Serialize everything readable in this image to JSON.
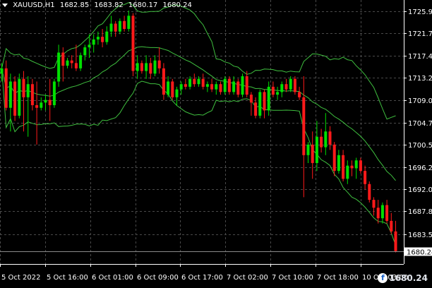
{
  "header": {
    "symbol": "XAUUSD,H1",
    "ohlc": [
      "1682.85",
      "1683.82",
      "1680.17",
      "1680.24"
    ]
  },
  "current_price_label": "1680.24",
  "watermark": "f 1680.24",
  "colors": {
    "background": "#000000",
    "bull": "#00e000",
    "bear": "#ff1a1a",
    "grid": "#4a4a4a",
    "bands": "#3fbf3f",
    "axis_text": "#ffffff"
  },
  "chart_data": {
    "type": "candlestick",
    "title": "",
    "xlabel": "",
    "ylabel": "",
    "ylim": [
      1677.8,
      1728.0
    ],
    "y_ticks": [
      "1725.90",
      "1721.75",
      "1717.40",
      "1713.20",
      "1709.00",
      "1704.70",
      "1700.55",
      "1696.20",
      "1692.00",
      "1687.80",
      "1683.50"
    ],
    "x_ticks": [
      "5 Oct 2022",
      "5 Oct 16:00",
      "6 Oct 01:00",
      "6 Oct 09:00",
      "6 Oct 17:00",
      "7 Oct 02:00",
      "7 Oct 10:00",
      "7 Oct 18:00",
      "10 Oct 03:00"
    ],
    "grid": true,
    "indicator": "Bollinger Bands",
    "candles_ohlc": [
      [
        1714.0,
        1716.0,
        1712.5,
        1715.0
      ],
      [
        1715.0,
        1716.5,
        1707.0,
        1707.5
      ],
      [
        1707.5,
        1714.0,
        1703.0,
        1712.5
      ],
      [
        1712.5,
        1713.5,
        1705.0,
        1706.0
      ],
      [
        1706.0,
        1714.0,
        1705.5,
        1713.0
      ],
      [
        1713.0,
        1714.5,
        1703.0,
        1709.5
      ],
      [
        1709.5,
        1713.5,
        1702.0,
        1712.0
      ],
      [
        1712.0,
        1713.0,
        1707.0,
        1708.0
      ],
      [
        1708.0,
        1712.5,
        1700.5,
        1707.5
      ],
      [
        1707.5,
        1709.5,
        1707.0,
        1708.5
      ],
      [
        1708.5,
        1710.0,
        1707.0,
        1709.0
      ],
      [
        1709.0,
        1713.0,
        1705.0,
        1708.0
      ],
      [
        1708.0,
        1713.0,
        1707.5,
        1712.5
      ],
      [
        1712.5,
        1719.5,
        1711.5,
        1718.0
      ],
      [
        1718.0,
        1719.0,
        1712.5,
        1715.5
      ],
      [
        1715.5,
        1717.0,
        1715.0,
        1716.5
      ],
      [
        1716.5,
        1717.5,
        1715.0,
        1716.0
      ],
      [
        1716.0,
        1719.5,
        1714.5,
        1715.0
      ],
      [
        1715.0,
        1718.0,
        1714.5,
        1717.5
      ],
      [
        1717.5,
        1719.5,
        1716.5,
        1719.0
      ],
      [
        1719.0,
        1721.5,
        1717.0,
        1719.5
      ],
      [
        1719.5,
        1721.5,
        1718.0,
        1720.5
      ],
      [
        1720.5,
        1722.0,
        1719.5,
        1721.0
      ],
      [
        1721.0,
        1722.5,
        1719.0,
        1720.0
      ],
      [
        1720.0,
        1723.0,
        1719.5,
        1722.0
      ],
      [
        1722.0,
        1725.0,
        1721.0,
        1723.5
      ],
      [
        1723.5,
        1724.0,
        1721.0,
        1722.0
      ],
      [
        1722.0,
        1724.5,
        1721.5,
        1724.0
      ],
      [
        1724.0,
        1725.0,
        1722.0,
        1722.5
      ],
      [
        1722.5,
        1726.0,
        1722.0,
        1725.0
      ],
      [
        1725.0,
        1725.5,
        1713.5,
        1714.5
      ],
      [
        1714.5,
        1717.5,
        1713.0,
        1716.0
      ],
      [
        1716.0,
        1716.5,
        1714.0,
        1714.5
      ],
      [
        1714.5,
        1717.5,
        1713.0,
        1716.0
      ],
      [
        1716.0,
        1717.0,
        1713.0,
        1714.0
      ],
      [
        1714.0,
        1717.5,
        1713.5,
        1716.5
      ],
      [
        1716.5,
        1719.0,
        1714.0,
        1715.0
      ],
      [
        1715.0,
        1716.0,
        1709.0,
        1710.0
      ],
      [
        1710.0,
        1713.5,
        1709.5,
        1712.5
      ],
      [
        1712.5,
        1713.0,
        1709.0,
        1709.5
      ],
      [
        1709.5,
        1711.5,
        1708.0,
        1711.0
      ],
      [
        1711.0,
        1712.5,
        1710.0,
        1712.0
      ],
      [
        1712.0,
        1713.0,
        1711.0,
        1711.5
      ],
      [
        1711.5,
        1713.5,
        1711.0,
        1713.0
      ],
      [
        1713.0,
        1714.0,
        1711.5,
        1712.0
      ],
      [
        1712.0,
        1713.5,
        1711.5,
        1713.0
      ],
      [
        1713.0,
        1714.0,
        1711.0,
        1711.5
      ],
      [
        1711.5,
        1712.5,
        1710.5,
        1712.0
      ],
      [
        1712.0,
        1713.0,
        1710.5,
        1711.0
      ],
      [
        1711.0,
        1712.5,
        1710.0,
        1712.0
      ],
      [
        1712.0,
        1712.5,
        1710.0,
        1710.5
      ],
      [
        1710.5,
        1713.5,
        1710.0,
        1713.0
      ],
      [
        1713.0,
        1713.5,
        1710.0,
        1710.5
      ],
      [
        1710.5,
        1713.5,
        1710.0,
        1712.5
      ],
      [
        1712.5,
        1713.0,
        1709.5,
        1710.0
      ],
      [
        1710.0,
        1714.0,
        1709.5,
        1713.5
      ],
      [
        1713.5,
        1714.5,
        1709.5,
        1710.0
      ],
      [
        1710.0,
        1710.5,
        1706.0,
        1708.5
      ],
      [
        1708.5,
        1709.5,
        1705.5,
        1706.0
      ],
      [
        1706.0,
        1711.0,
        1705.5,
        1710.5
      ],
      [
        1710.5,
        1711.0,
        1705.5,
        1707.0
      ],
      [
        1707.0,
        1712.5,
        1706.0,
        1711.5
      ],
      [
        1711.5,
        1712.5,
        1709.5,
        1710.0
      ],
      [
        1710.0,
        1711.5,
        1709.0,
        1710.5
      ],
      [
        1710.5,
        1712.5,
        1709.5,
        1712.0
      ],
      [
        1712.0,
        1713.0,
        1710.5,
        1711.0
      ],
      [
        1711.0,
        1713.5,
        1710.5,
        1713.0
      ],
      [
        1713.0,
        1713.5,
        1710.0,
        1710.5
      ],
      [
        1710.5,
        1711.5,
        1709.0,
        1709.5
      ],
      [
        1709.5,
        1713.5,
        1690.5,
        1698.5
      ],
      [
        1698.5,
        1701.0,
        1697.0,
        1700.5
      ],
      [
        1700.5,
        1703.0,
        1694.0,
        1697.0
      ],
      [
        1697.0,
        1705.0,
        1695.5,
        1702.0
      ],
      [
        1702.0,
        1703.5,
        1699.0,
        1700.0
      ],
      [
        1700.0,
        1706.5,
        1698.5,
        1703.0
      ],
      [
        1703.0,
        1704.0,
        1699.5,
        1700.5
      ],
      [
        1700.5,
        1701.0,
        1694.5,
        1695.5
      ],
      [
        1695.5,
        1699.5,
        1695.0,
        1698.5
      ],
      [
        1698.5,
        1699.5,
        1693.5,
        1694.0
      ],
      [
        1694.0,
        1697.5,
        1693.0,
        1696.5
      ],
      [
        1696.5,
        1697.5,
        1694.5,
        1696.0
      ],
      [
        1696.0,
        1698.0,
        1694.0,
        1697.5
      ],
      [
        1697.5,
        1698.0,
        1695.0,
        1695.5
      ],
      [
        1695.5,
        1696.5,
        1692.0,
        1693.0
      ],
      [
        1693.0,
        1693.5,
        1689.5,
        1690.0
      ],
      [
        1690.0,
        1690.5,
        1687.0,
        1688.5
      ],
      [
        1688.5,
        1690.0,
        1685.5,
        1686.5
      ],
      [
        1686.5,
        1689.5,
        1685.5,
        1689.0
      ],
      [
        1689.0,
        1690.0,
        1685.5,
        1686.0
      ],
      [
        1686.0,
        1687.5,
        1683.5,
        1684.0
      ],
      [
        1684.0,
        1686.0,
        1680.0,
        1680.24
      ]
    ]
  }
}
